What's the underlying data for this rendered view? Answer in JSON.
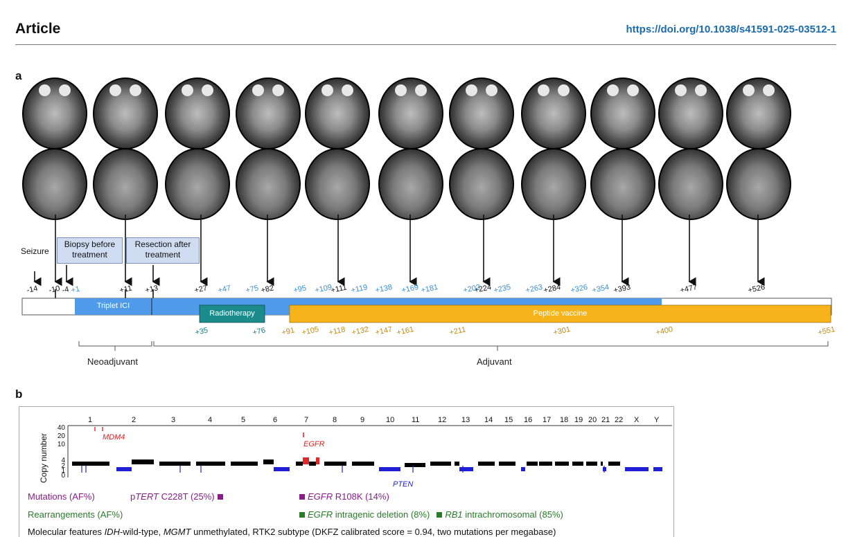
{
  "header": {
    "article": "Article",
    "doi": "https://doi.org/10.1038/s41591-025-03512-1"
  },
  "panels": {
    "a": "a",
    "b": "b"
  },
  "events": {
    "seizure": "Seizure",
    "biopsy": "Biopsy before treatment",
    "resection": "Resection after treatment"
  },
  "bars": {
    "triplet": "Triplet ICI",
    "radiotherapy": "Radiotherapy",
    "vaccine": "Peptide vaccine"
  },
  "phases": {
    "neoadjuvant": "Neoadjuvant",
    "adjuvant": "Adjuvant"
  },
  "days_black": [
    "-14",
    "-10",
    "-4",
    "+11",
    "+13",
    "+27",
    "+82",
    "+111",
    "+224",
    "+284",
    "+393",
    "+477",
    "+526"
  ],
  "days_blue": [
    "+1",
    "+47",
    "+75",
    "+95",
    "+109",
    "+119",
    "+138",
    "+169",
    "+181",
    "+202",
    "+235",
    "+263",
    "+326",
    "+354"
  ],
  "days_teal": [
    "+35",
    "+76"
  ],
  "days_orange": [
    "+91",
    "+105",
    "+118",
    "+132",
    "+147",
    "+161",
    "+211",
    "+301",
    "+400",
    "+551"
  ],
  "colors": {
    "triplet": "#4f9bea",
    "radiotherapy": "#1b8c8b",
    "vaccine": "#f6b41a",
    "amp": "#e0292a",
    "loss": "#1f1fd8",
    "mutation": "#8a1d8a",
    "rearr": "#2a7a2a"
  },
  "cnv": {
    "ylabel": "Copy number",
    "yticks": [
      "40",
      "20",
      "10",
      "4",
      "2",
      "1",
      "0"
    ],
    "chromosomes": [
      "1",
      "2",
      "3",
      "4",
      "5",
      "6",
      "7",
      "8",
      "9",
      "10",
      "11",
      "12",
      "13",
      "14",
      "15",
      "16",
      "17",
      "18",
      "19",
      "20",
      "21",
      "22",
      "X",
      "Y"
    ],
    "genes": {
      "mdm4": "MDM4",
      "egfr": "EGFR",
      "pten": "PTEN"
    }
  },
  "molecular": {
    "mutations_label": "Mutations (AF%)",
    "tert_prefix": "p",
    "tert_gene": "TERT",
    "tert_rest": " C228T (25%)",
    "egfr_mut_gene": "EGFR",
    "egfr_mut_rest": " R108K (14%)",
    "rearr_label": "Rearrangements (AF%)",
    "egfr_del_gene": "EGFR",
    "egfr_del_rest": " intragenic deletion (8%)",
    "rb1_gene": "RB1",
    "rb1_rest": " intrachromosomal (85%)",
    "features_prefix": "Molecular features ",
    "idh": "IDH",
    "features_mid": "-wild-type, ",
    "mgmt": "MGMT",
    "features_rest": " unmethylated, RTK2 subtype (DKFZ calibrated score = 0.94, two mutations per megabase)"
  }
}
